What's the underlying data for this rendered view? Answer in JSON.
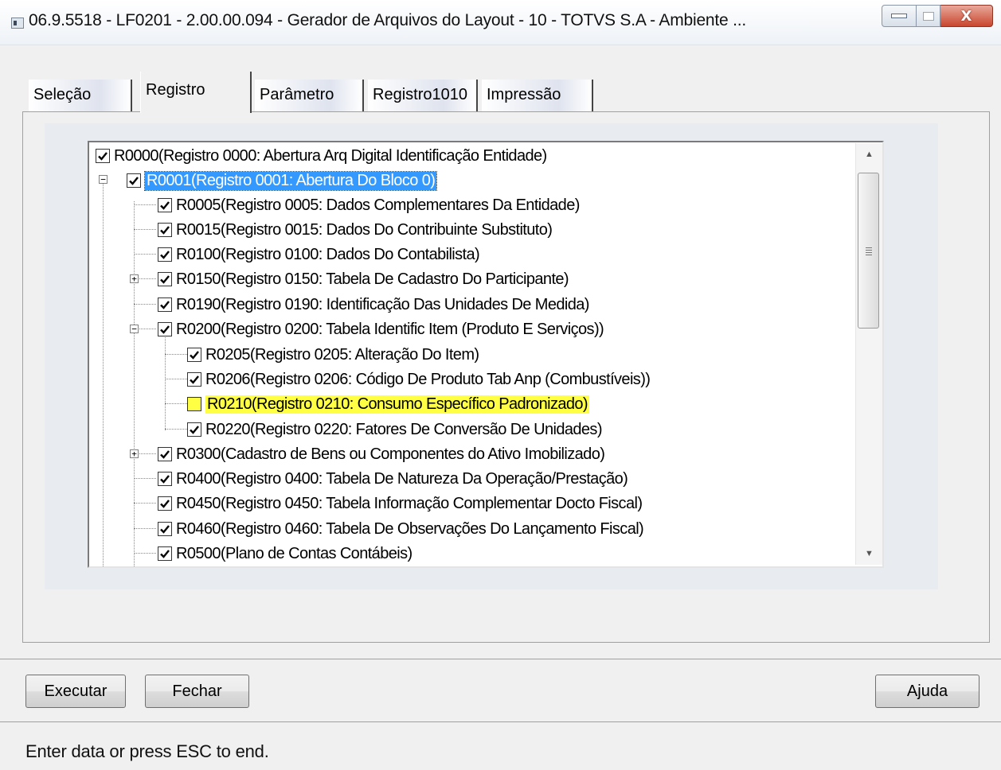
{
  "window": {
    "title": "06.9.5518 - LF0201 - 2.00.00.094 - Gerador de Arquivos do Layout - 10 - TOTVS S.A - Ambiente ...",
    "close_glyph": "X"
  },
  "tabs": [
    {
      "label": "Seleção",
      "active": false
    },
    {
      "label": "Registro",
      "active": true
    },
    {
      "label": "Parâmetro",
      "active": false
    },
    {
      "label": "Registro1010",
      "active": false
    },
    {
      "label": "Impressão",
      "active": false
    }
  ],
  "tree": {
    "items": [
      {
        "label": "R0000(Registro 0000: Abertura Arq Digital Identificação Entidade)",
        "checked": true
      },
      {
        "label": "R0001(Registro 0001: Abertura Do Bloco 0)",
        "checked": true,
        "selected": true,
        "expanded": true
      },
      {
        "label": "R0005(Registro 0005: Dados Complementares Da Entidade)",
        "checked": true
      },
      {
        "label": "R0015(Registro 0015: Dados Do Contribuinte Substituto)",
        "checked": true
      },
      {
        "label": "R0100(Registro 0100: Dados Do Contabilista)",
        "checked": true
      },
      {
        "label": "R0150(Registro 0150: Tabela De Cadastro Do Participante)",
        "checked": true,
        "expanded": false
      },
      {
        "label": "R0190(Registro 0190: Identificação Das Unidades De Medida)",
        "checked": true
      },
      {
        "label": "R0200(Registro 0200: Tabela Identific Item (Produto E Serviços))",
        "checked": true,
        "expanded": true
      },
      {
        "label": "R0205(Registro 0205: Alteração Do Item)",
        "checked": true
      },
      {
        "label": "R0206(Registro 0206: Código De Produto Tab Anp (Combustíveis))",
        "checked": true
      },
      {
        "label": "R0210(Registro 0210: Consumo Específico Padronizado)",
        "checked": false,
        "highlighted": true
      },
      {
        "label": "R0220(Registro 0220: Fatores De Conversão De Unidades)",
        "checked": true
      },
      {
        "label": "R0300(Cadastro de Bens ou Componentes do Ativo Imobilizado)",
        "checked": true,
        "expanded": false
      },
      {
        "label": "R0400(Registro 0400: Tabela De Natureza Da Operação/Prestação)",
        "checked": true
      },
      {
        "label": "R0450(Registro 0450: Tabela Informação Complementar Docto Fiscal)",
        "checked": true
      },
      {
        "label": "R0460(Registro 0460: Tabela De Observações Do Lançamento Fiscal)",
        "checked": true
      },
      {
        "label": "R0500(Plano de Contas Contábeis)",
        "checked": true
      }
    ]
  },
  "buttons": {
    "executar": "Executar",
    "fechar": "Fechar",
    "ajuda": "Ajuda"
  },
  "status_bar": "Enter data or press ESC to end.",
  "colors": {
    "selection": "#3399ff",
    "highlight": "#ffff44",
    "close_button": "#c9462f"
  }
}
